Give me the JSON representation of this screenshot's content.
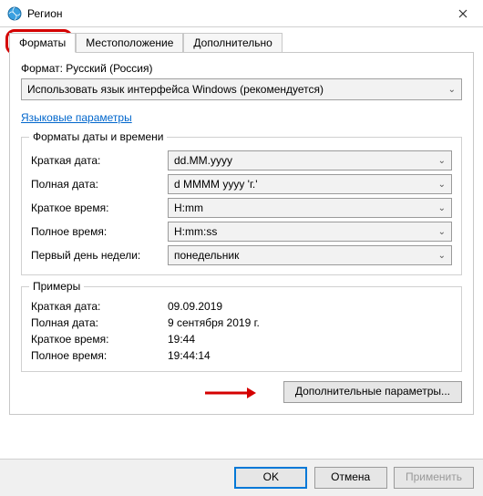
{
  "window": {
    "title": "Регион"
  },
  "tabs": {
    "formats": "Форматы",
    "location": "Местоположение",
    "advanced": "Дополнительно"
  },
  "format": {
    "label": "Формат: Русский (Россия)",
    "value": "Использовать язык интерфейса Windows (рекомендуется)"
  },
  "lang_link": "Языковые параметры",
  "dt_group": {
    "title": "Форматы даты и времени",
    "rows": [
      {
        "label": "Краткая дата:",
        "value": "dd.MM.yyyy"
      },
      {
        "label": "Полная дата:",
        "value": "d MMMM yyyy 'г.'"
      },
      {
        "label": "Краткое время:",
        "value": "H:mm"
      },
      {
        "label": "Полное время:",
        "value": "H:mm:ss"
      },
      {
        "label": "Первый день недели:",
        "value": "понедельник"
      }
    ]
  },
  "examples": {
    "title": "Примеры",
    "rows": [
      {
        "label": "Краткая дата:",
        "value": "09.09.2019"
      },
      {
        "label": "Полная дата:",
        "value": "9 сентября 2019 г."
      },
      {
        "label": "Краткое время:",
        "value": "19:44"
      },
      {
        "label": "Полное время:",
        "value": "19:44:14"
      }
    ]
  },
  "more_btn": "Дополнительные параметры...",
  "buttons": {
    "ok": "OK",
    "cancel": "Отмена",
    "apply": "Применить"
  }
}
